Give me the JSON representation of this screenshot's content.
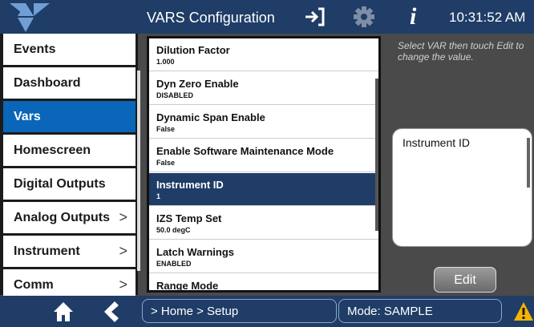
{
  "header": {
    "title": "VARS Configuration",
    "time": "10:31:52 AM"
  },
  "sidebar": {
    "items": [
      {
        "label": "Events",
        "active": false,
        "has_chevron": false
      },
      {
        "label": "Dashboard",
        "active": false,
        "has_chevron": false
      },
      {
        "label": "Vars",
        "active": true,
        "has_chevron": false
      },
      {
        "label": "Homescreen",
        "active": false,
        "has_chevron": false
      },
      {
        "label": "Digital Outputs",
        "active": false,
        "has_chevron": false
      },
      {
        "label": "Analog Outputs",
        "active": false,
        "has_chevron": true
      },
      {
        "label": "Instrument",
        "active": false,
        "has_chevron": true
      },
      {
        "label": "Comm",
        "active": false,
        "has_chevron": true
      }
    ]
  },
  "vars_list": [
    {
      "name": "Dilution Factor",
      "value": "1.000",
      "selected": false
    },
    {
      "name": "Dyn Zero Enable",
      "value": "DISABLED",
      "selected": false
    },
    {
      "name": "Dynamic Span Enable",
      "value": "False",
      "selected": false
    },
    {
      "name": "Enable Software Maintenance Mode",
      "value": "False",
      "selected": false
    },
    {
      "name": "Instrument ID",
      "value": "1",
      "selected": true
    },
    {
      "name": "IZS Temp Set",
      "value": "50.0 degC",
      "selected": false
    },
    {
      "name": "Latch Warnings",
      "value": "ENABLED",
      "selected": false
    },
    {
      "name": "Range Mode",
      "value": "",
      "selected": false
    }
  ],
  "help_text": "Select VAR then touch Edit to change the value.",
  "detail": {
    "label": "Instrument ID"
  },
  "edit_button": "Edit",
  "footer": {
    "breadcrumb": "> Home > Setup",
    "mode": "Mode: SAMPLE"
  },
  "icons": {
    "exit": "exit-icon",
    "settings": "gear-icon",
    "info": "info-icon",
    "home": "home-icon",
    "back": "back-icon",
    "warning": "warning-icon"
  },
  "colors": {
    "header": "#1f3d66",
    "accent": "#0a66b8",
    "selected_row": "#1f3d66",
    "warning": "#f5b400"
  }
}
